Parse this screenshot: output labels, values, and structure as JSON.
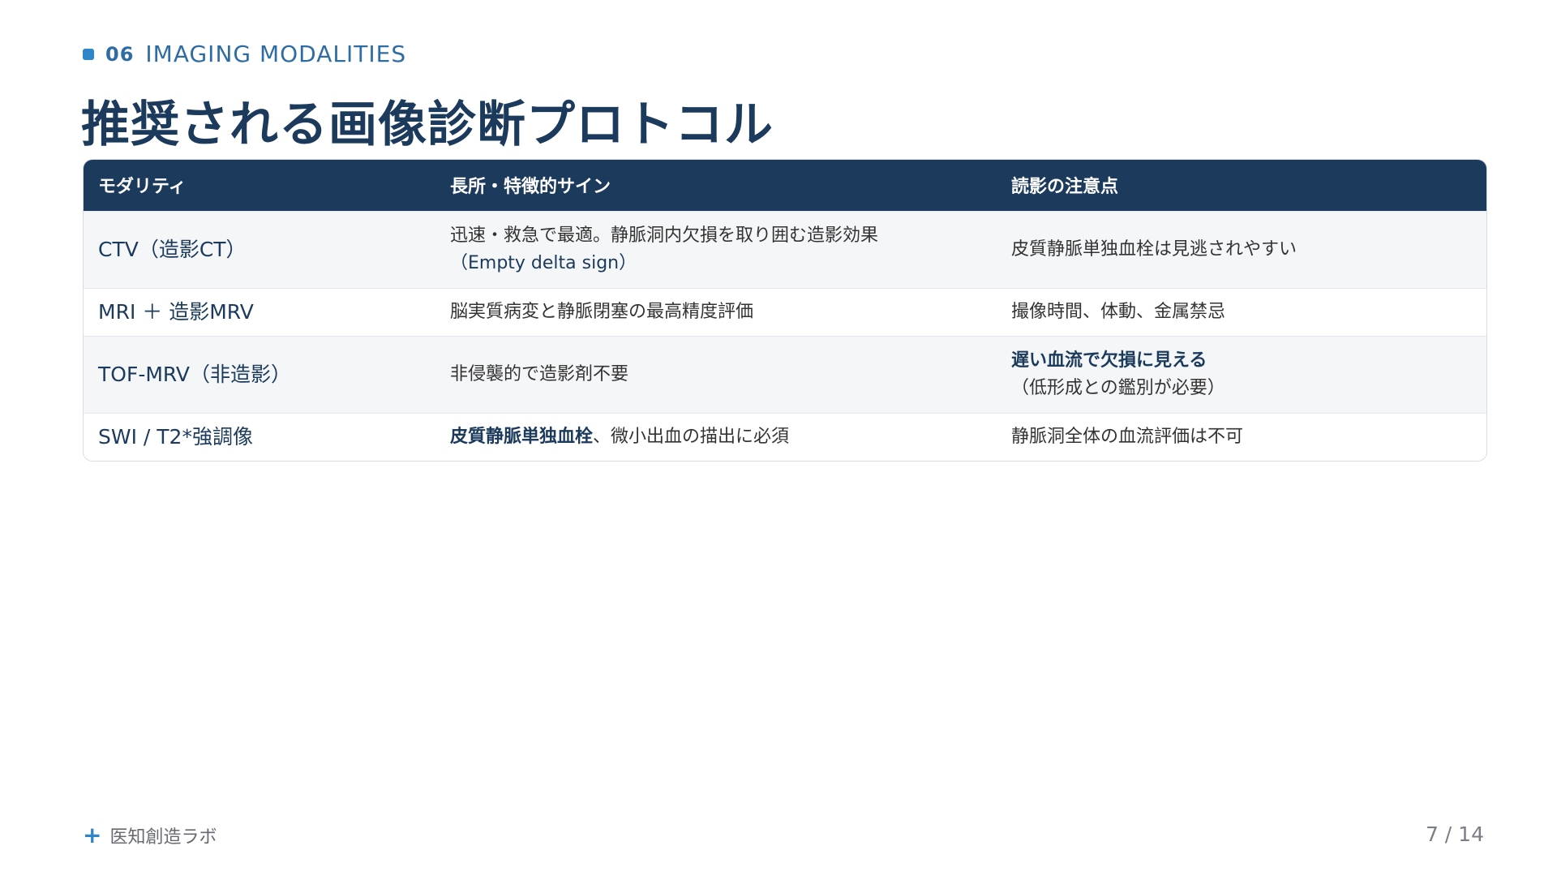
{
  "section": {
    "number": "06",
    "title": "IMAGING MODALITIES"
  },
  "title": "推奨される画像診断プロトコル",
  "table": {
    "headers": [
      "モダリティ",
      "長所・特徴的サイン",
      "読影の注意点"
    ],
    "rows": [
      {
        "modality": "CTV（造影CT）",
        "strength_line1": "迅速・救急で最適。静脈洞内欠損を取り囲む造影効果",
        "strength_line2": "（Empty delta sign）",
        "caution": "皮質静脈単独血栓は見逃されやすい"
      },
      {
        "modality": "MRI ＋ 造影MRV",
        "strength": "脳実質病変と静脈閉塞の最高精度評価",
        "caution": "撮像時間、体動、金属禁忌"
      },
      {
        "modality": "TOF-MRV（非造影）",
        "strength": "非侵襲的で造影剤不要",
        "caution_highlight": "遅い血流で欠損に見える",
        "caution_line2": "（低形成との鑑別が必要）"
      },
      {
        "modality": "SWI / T2*強調像",
        "strength_highlight": "皮質静脈単独血栓",
        "strength_rest": "、微小出血の描出に必須",
        "caution": "静脈洞全体の血流評価は不可"
      }
    ]
  },
  "footer": {
    "brand": "医知創造ラボ",
    "page": "7 / 14"
  },
  "colors": {
    "navy": "#1b3a5c",
    "accent": "#2e86c9",
    "row_alt": "#f4f6f8"
  }
}
